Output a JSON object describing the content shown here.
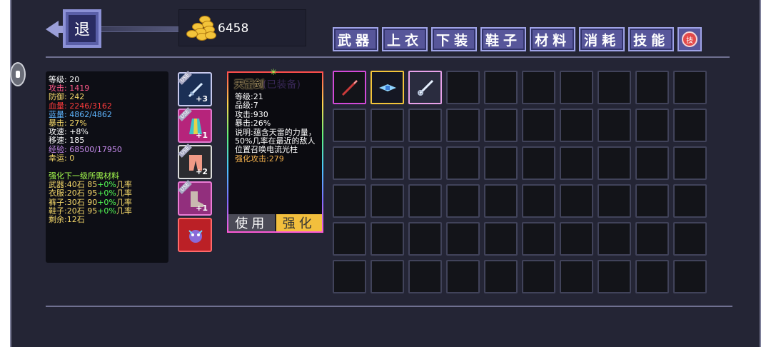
{
  "back_button": {
    "label": "退"
  },
  "gold": {
    "amount": "6458"
  },
  "tabs": [
    {
      "label": "武器"
    },
    {
      "label": "上衣"
    },
    {
      "label": "下装"
    },
    {
      "label": "鞋子"
    },
    {
      "label": "材料"
    },
    {
      "label": "消耗"
    },
    {
      "label": "技能"
    }
  ],
  "skill_icon": {
    "label": "技"
  },
  "stats": {
    "level": {
      "text": "等级: 20",
      "color": "#ffffff"
    },
    "attack": {
      "text": "攻击: 1419",
      "color": "#ff5a8a"
    },
    "defense": {
      "text": "防御: 242",
      "color": "#f6d96a"
    },
    "hp": {
      "text": "血量: 2246/3162",
      "color": "#ff3c3c"
    },
    "mp": {
      "text": "蓝量: 4862/4862",
      "color": "#5fb5ff"
    },
    "crit": {
      "text": "暴击: 27%",
      "color": "#f6d96a"
    },
    "attack_speed": {
      "text": "攻速: +8%",
      "color": "#ffffff"
    },
    "move_speed": {
      "text": "移速: 185",
      "color": "#ffffff"
    },
    "exp": {
      "text": "经验: 68500/17950",
      "color": "#c98df0"
    },
    "luck": {
      "text": "幸运: 0",
      "color": "#f6d96a"
    }
  },
  "upgrade": {
    "title": "强化下一级所需材料",
    "lines": [
      {
        "prefix": "武器:40石 85",
        "bonus": "+0%",
        "suffix": "几率"
      },
      {
        "prefix": "衣服:20石 95",
        "bonus": "+0%",
        "suffix": "几率"
      },
      {
        "prefix": "裤子:30石 90",
        "bonus": "+0%",
        "suffix": "几率"
      },
      {
        "prefix": "鞋子:20石 95",
        "bonus": "+0%",
        "suffix": "几率"
      }
    ],
    "remaining": "剩余:12石"
  },
  "equipment": {
    "use_tag": "USE",
    "weapon_plus": "+3",
    "armor_plus": "+1",
    "pants_plus": "+2",
    "boots_plus": "+1"
  },
  "item_detail": {
    "name": "天雷剑",
    "name_ghost": "(已装备)",
    "level": "等级:21",
    "grade": "品级:7",
    "attack": "攻击:930",
    "crit": "暴击:26%",
    "description": "说明:蕴含天雷的力量，50%几率在最近的敌人位置召唤电流光柱",
    "enhance_attack": "强化攻击:279",
    "use_label": "使用",
    "enhance_label": "强化"
  },
  "colors": {
    "frame_bg": "#242535",
    "tab_bg": "#57569a",
    "tab_border": "#9fa3e6",
    "enhance_button": "#f2bf3d",
    "use_button": "#4b4b57",
    "accent_green": "#55ff55",
    "gold_coin": "#f3c43a"
  },
  "inventory": {
    "columns": 10,
    "rows": 6,
    "items": [
      "red-sword-icon",
      "ice-blade-icon",
      "silver-sword-icon"
    ]
  }
}
